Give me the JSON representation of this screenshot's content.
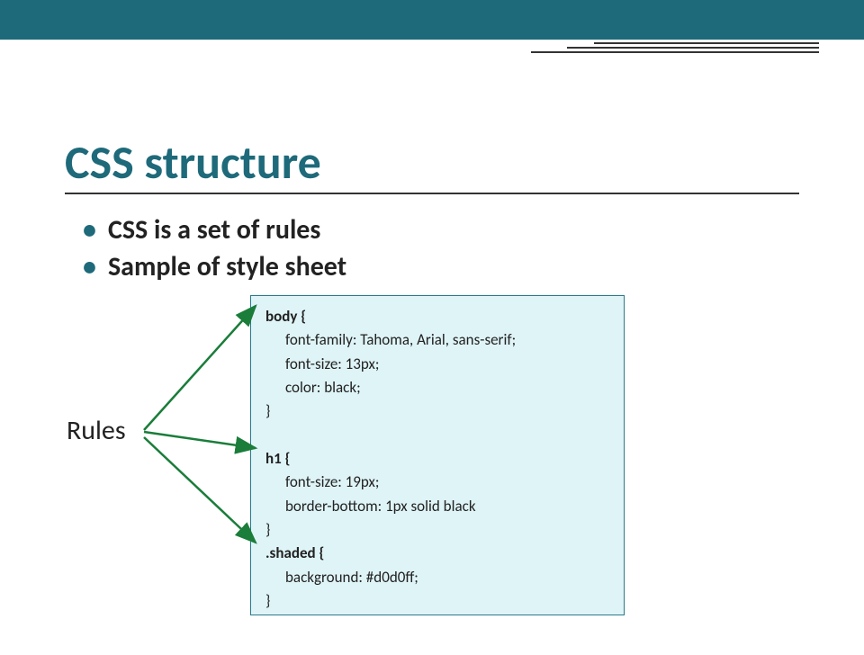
{
  "title": "CSS structure",
  "bullets": [
    "CSS is a set of rules",
    "Sample of style sheet"
  ],
  "rules_label": "Rules",
  "code": {
    "rule1_selector": "body {",
    "rule1_lines": [
      "font-family: Tahoma, Arial, sans-serif;",
      "font-size: 13px;",
      "color: black;"
    ],
    "rule1_close": "}",
    "rule2_selector": "h1 {",
    "rule2_lines": [
      "font-size: 19px;",
      "border-bottom: 1px solid black"
    ],
    "rule2_close": "}",
    "rule3_selector": ".shaded {",
    "rule3_lines": [
      "background: #d0d0ff;"
    ],
    "rule3_close": "}"
  },
  "colors": {
    "accent": "#1e6a7a",
    "code_bg": "#dff4f7",
    "arrow": "#1a7d3a"
  }
}
